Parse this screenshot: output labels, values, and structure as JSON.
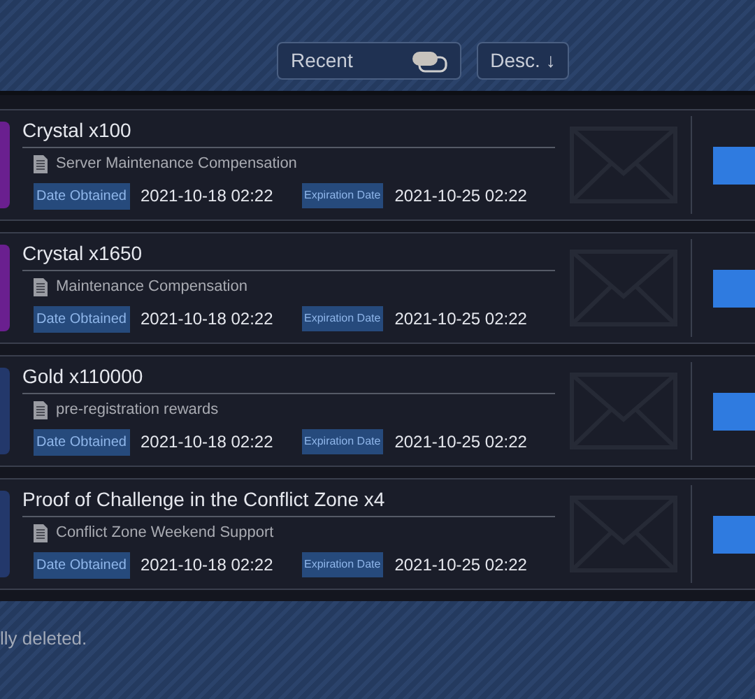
{
  "filters": {
    "sort_field": "Recent",
    "order": "Desc. ↓"
  },
  "mails": [
    {
      "title": "Crystal  x100",
      "subject": "Server Maintenance Compensation",
      "obtained_label": "Date Obtained",
      "obtained": "2021-10-18  02:22",
      "expiry_label": "Expiration Date",
      "expiry": "2021-10-25  02:22",
      "color": "#6a1f8f"
    },
    {
      "title": "Crystal  x1650",
      "subject": "Maintenance Compensation",
      "obtained_label": "Date Obtained",
      "obtained": "2021-10-18  02:22",
      "expiry_label": "Expiration Date",
      "expiry": "2021-10-25  02:22",
      "color": "#6a1f8f"
    },
    {
      "title": "Gold  x110000",
      "subject": "pre-registration rewards",
      "obtained_label": "Date Obtained",
      "obtained": "2021-10-18  02:22",
      "expiry_label": "Expiration Date",
      "expiry": "2021-10-25  02:22",
      "color": "#23386b"
    },
    {
      "title": "Proof of Challenge in the Conflict Zone  x4",
      "subject": "Conflict Zone Weekend Support",
      "obtained_label": "Date Obtained",
      "obtained": "2021-10-18  02:22",
      "expiry_label": "Expiration Date",
      "expiry": "2021-10-25  02:22",
      "color": "#23386b"
    }
  ],
  "footer_note": "lly deleted."
}
